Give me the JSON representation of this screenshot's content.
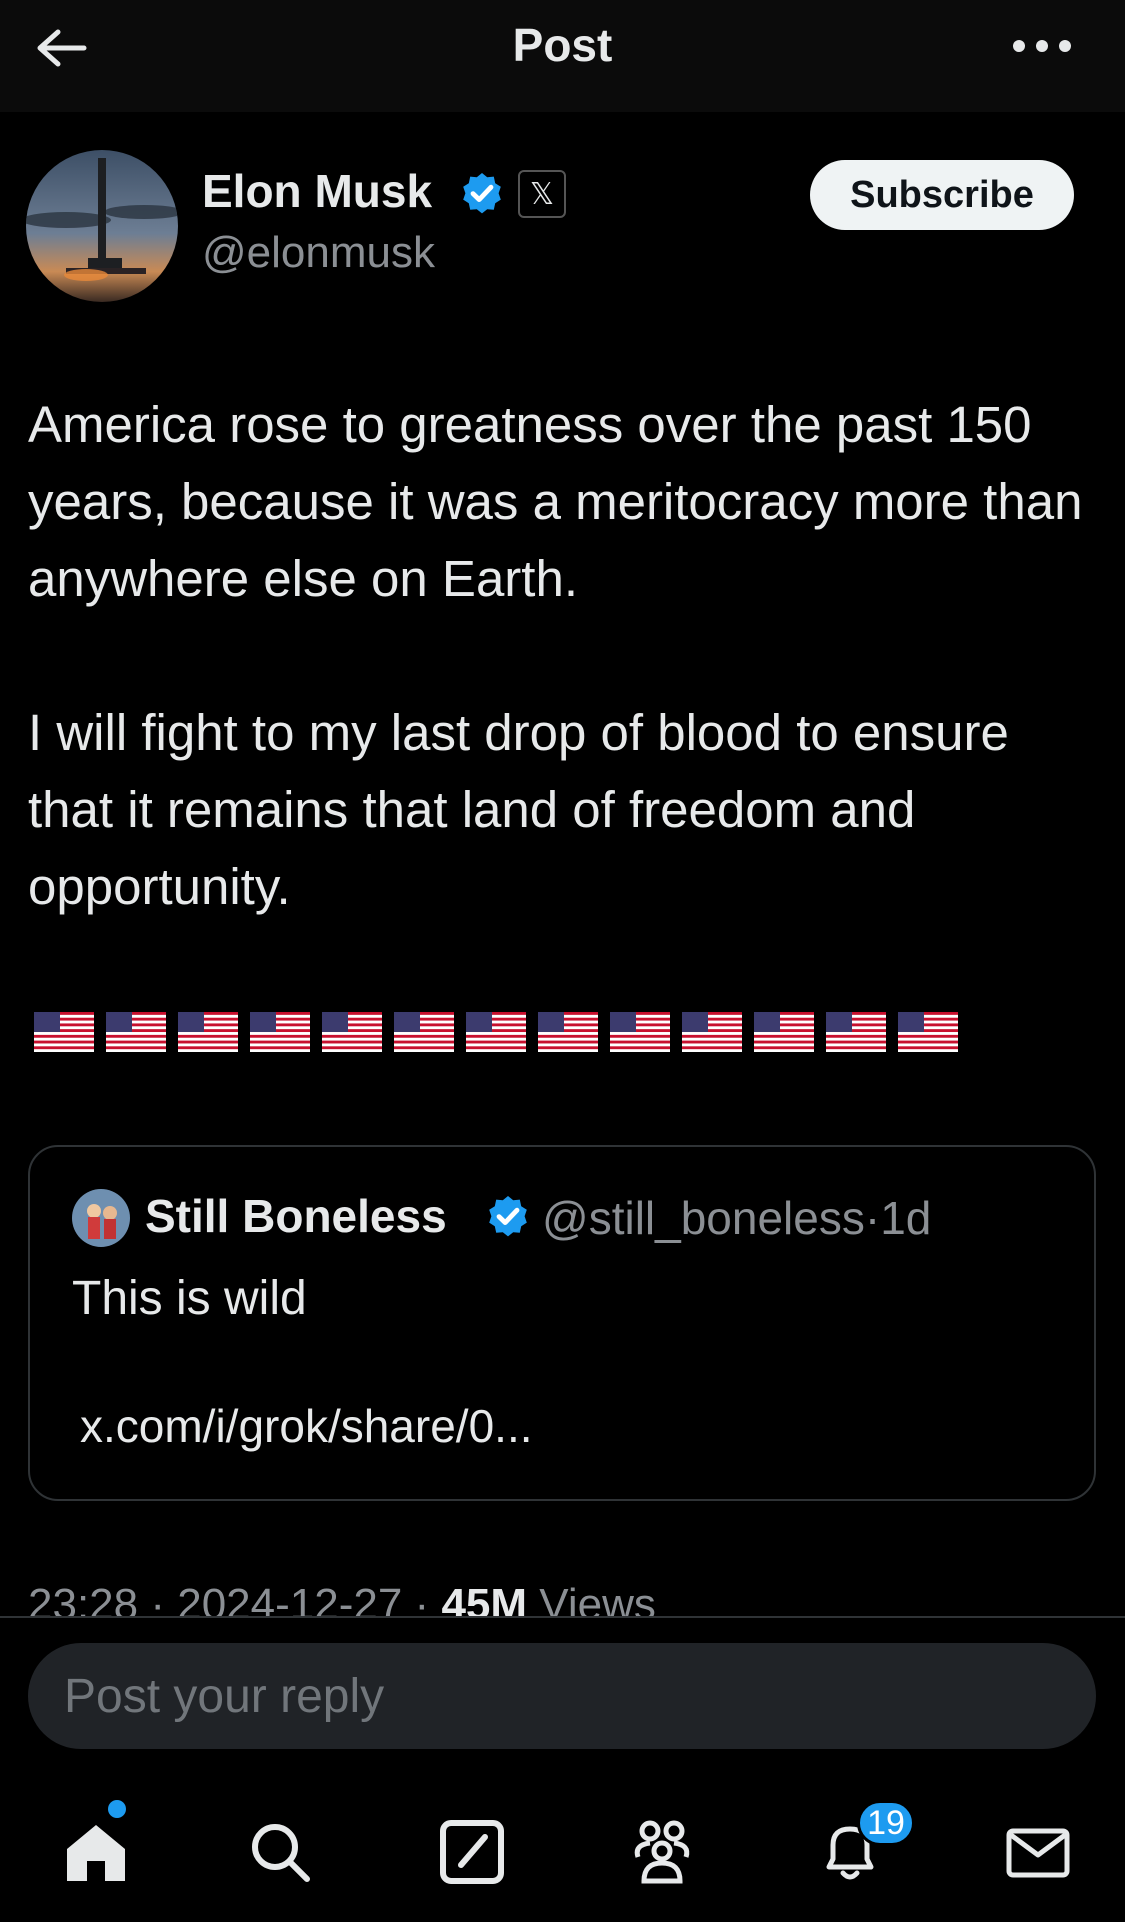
{
  "header": {
    "title": "Post",
    "back_icon": "arrow-left-icon",
    "more_icon": "more-horizontal-icon"
  },
  "author": {
    "name": "Elon Musk",
    "handle": "@elonmusk",
    "verified_color": "#1d9bf0",
    "affiliation_badge": "𝕏"
  },
  "subscribe_label": "Subscribe",
  "post": {
    "paragraph_1": "America rose to greatness over the past 150 years, because it was a meritocracy more than anywhere else on Earth.",
    "paragraph_2": "I will fight to my last drop of blood to ensure that it remains that land of freedom and opportunity.",
    "flag_emoji": "🇺🇸",
    "flag_count": 13
  },
  "quote": {
    "name": "Still Boneless",
    "handle": "@still_boneless",
    "age": "1d",
    "text": "This is wild",
    "link": "x.com/i/grok/share/0..."
  },
  "meta": {
    "time": "23:28",
    "date": "2024-12-27",
    "views_count": "45M",
    "views_label": "Views"
  },
  "reply": {
    "placeholder": "Post your reply"
  },
  "nav": {
    "notification_count": "19",
    "accent": "#1d9bf0"
  }
}
